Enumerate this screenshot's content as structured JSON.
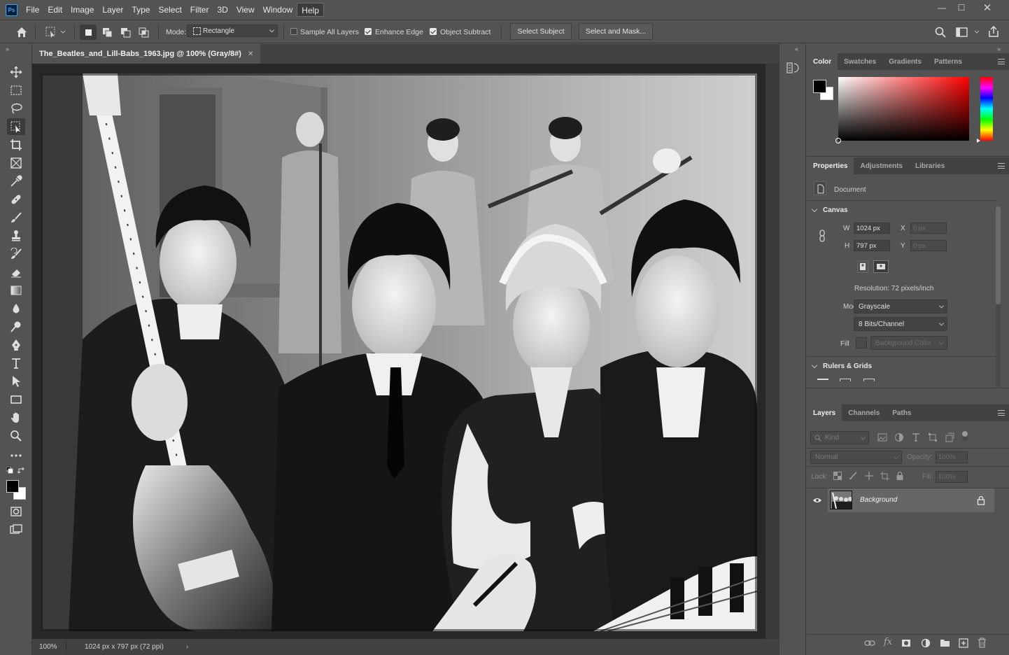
{
  "app": {
    "logo_text": "Ps"
  },
  "menu": [
    "File",
    "Edit",
    "Image",
    "Layer",
    "Type",
    "Select",
    "Filter",
    "3D",
    "View",
    "Window",
    "Help"
  ],
  "options": {
    "mode_label": "Mode:",
    "mode_value": "Rectangle",
    "sample_all_layers": "Sample All Layers",
    "enhance_edge": "Enhance Edge",
    "object_subtract": "Object Subtract",
    "select_subject": "Select Subject",
    "select_and_mask": "Select and Mask..."
  },
  "document": {
    "tab_title": "The_Beatles_and_Lill-Babs_1963.jpg @ 100% (Gray/8#)",
    "zoom": "100%",
    "status_info": "1024 px x 797 px (72 ppi)"
  },
  "color_panel": {
    "tabs": [
      "Color",
      "Swatches",
      "Gradients",
      "Patterns"
    ],
    "active_tab": "Color",
    "foreground": "#000000",
    "background": "#ffffff",
    "hue": "#ff0000"
  },
  "properties_panel": {
    "tabs": [
      "Properties",
      "Adjustments",
      "Libraries"
    ],
    "doc_label": "Document",
    "canvas_title": "Canvas",
    "w_label": "W",
    "w_value": "1024 px",
    "h_label": "H",
    "h_value": "797 px",
    "x_label": "X",
    "x_value": "0 px",
    "y_label": "Y",
    "y_value": "0 px",
    "resolution": "Resolution: 72 pixels/inch",
    "mode_label": "Mode",
    "mode_value": "Grayscale",
    "bits_value": "8 Bits/Channel",
    "fill_label": "Fill",
    "fill_value": "Background Color",
    "rulers_title": "Rulers & Grids"
  },
  "layers_panel": {
    "tabs": [
      "Layers",
      "Channels",
      "Paths"
    ],
    "kind_label": "Kind",
    "blend_mode": "Normal",
    "opacity_label": "Opacity:",
    "opacity_value": "100%",
    "lock_label": "Lock:",
    "fill_label": "Fill:",
    "fill_value": "100%",
    "layers": [
      {
        "name": "Background",
        "visible": true,
        "locked": true
      }
    ]
  }
}
